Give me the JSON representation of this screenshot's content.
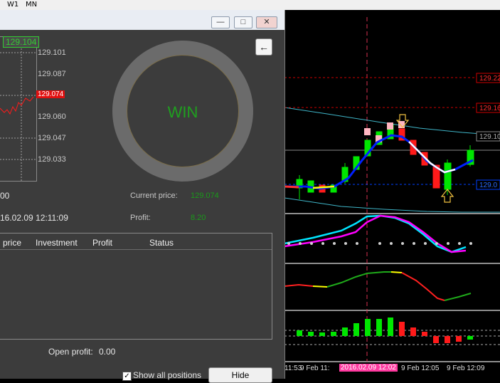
{
  "timeframes": [
    "W1",
    "MN"
  ],
  "panel": {
    "top_price": "129.104",
    "scale": [
      "129.101",
      "129.087",
      "129.074",
      "129.060",
      "129.047",
      "129.033"
    ],
    "result": "WIN",
    "amount_fragment": "00",
    "current_price_label": "Current price:",
    "current_price_value": "129.074",
    "datetime_fragment": "16.02.09 12:11:09",
    "profit_label": "Profit:",
    "profit_value": "8.20",
    "columns": [
      "price",
      "Investment",
      "Profit",
      "Status"
    ],
    "open_profit_label": "Open profit:",
    "open_profit_value": "0.00",
    "show_all_label": "Show all positions",
    "show_all_checked": true,
    "hide_label": "Hide",
    "window_buttons": {
      "minimize": "—",
      "maximize": "□",
      "close": "✕"
    }
  },
  "chart": {
    "price_tags": [
      "129.22",
      "129.16",
      "129.10",
      "129.0"
    ],
    "time_labels": [
      "11:53",
      "9 Feb 11:",
      "2016.02.09 12:02",
      "9 Feb 12:05",
      "9 Feb 12:09"
    ],
    "colors": {
      "bull": "#00e600",
      "bear": "#ff1a1a",
      "marker": "#ffb6c1",
      "accent": "#ff3aa0"
    }
  }
}
